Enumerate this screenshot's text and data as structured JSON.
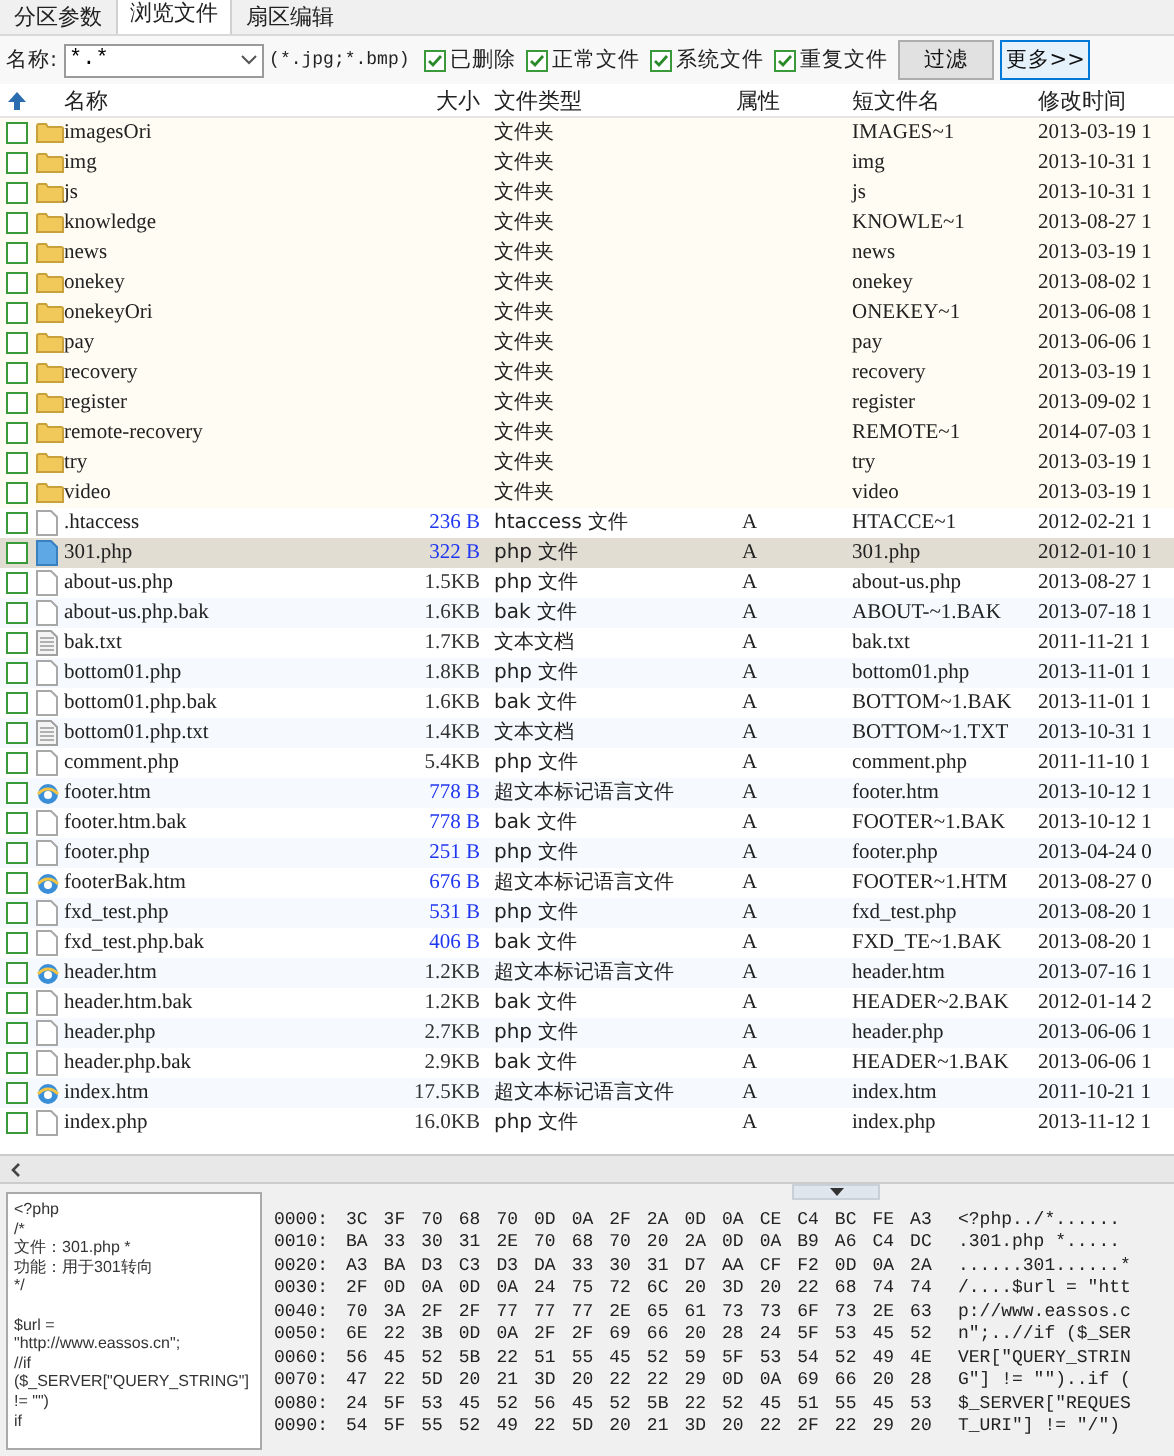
{
  "tabs": [
    {
      "label": "分区参数",
      "selected": false
    },
    {
      "label": "浏览文件",
      "selected": true
    },
    {
      "label": "扇区编辑",
      "selected": false
    }
  ],
  "filter": {
    "label": "名称:",
    "value": "*.*",
    "hint": "(*.jpg;*.bmp)",
    "options": [
      {
        "label": "已删除",
        "checked": true
      },
      {
        "label": "正常文件",
        "checked": true
      },
      {
        "label": "系统文件",
        "checked": true
      },
      {
        "label": "重复文件",
        "checked": true
      }
    ],
    "buttons": [
      {
        "label": "过滤",
        "focused": false
      },
      {
        "label": "更多>>",
        "focused": true
      }
    ]
  },
  "columns": [
    "名称",
    "大小",
    "文件类型",
    "属性",
    "短文件名",
    "修改时间"
  ],
  "rows": [
    {
      "kind": "folder",
      "name": "imagesOri",
      "size": "",
      "type": "文件夹",
      "attr": "",
      "short": "IMAGES~1",
      "modified": "2013-03-19 1",
      "checked": false,
      "selected": false
    },
    {
      "kind": "folder",
      "name": "img",
      "size": "",
      "type": "文件夹",
      "attr": "",
      "short": "img",
      "modified": "2013-10-31 1",
      "checked": false,
      "selected": false
    },
    {
      "kind": "folder",
      "name": "js",
      "size": "",
      "type": "文件夹",
      "attr": "",
      "short": "js",
      "modified": "2013-10-31 1",
      "checked": false,
      "selected": false
    },
    {
      "kind": "folder",
      "name": "knowledge",
      "size": "",
      "type": "文件夹",
      "attr": "",
      "short": "KNOWLE~1",
      "modified": "2013-08-27 1",
      "checked": false,
      "selected": false
    },
    {
      "kind": "folder",
      "name": "news",
      "size": "",
      "type": "文件夹",
      "attr": "",
      "short": "news",
      "modified": "2013-03-19 1",
      "checked": false,
      "selected": false
    },
    {
      "kind": "folder",
      "name": "onekey",
      "size": "",
      "type": "文件夹",
      "attr": "",
      "short": "onekey",
      "modified": "2013-08-02 1",
      "checked": false,
      "selected": false
    },
    {
      "kind": "folder",
      "name": "onekeyOri",
      "size": "",
      "type": "文件夹",
      "attr": "",
      "short": "ONEKEY~1",
      "modified": "2013-06-08 1",
      "checked": false,
      "selected": false
    },
    {
      "kind": "folder",
      "name": "pay",
      "size": "",
      "type": "文件夹",
      "attr": "",
      "short": "pay",
      "modified": "2013-06-06 1",
      "checked": false,
      "selected": false
    },
    {
      "kind": "folder",
      "name": "recovery",
      "size": "",
      "type": "文件夹",
      "attr": "",
      "short": "recovery",
      "modified": "2013-03-19 1",
      "checked": false,
      "selected": false
    },
    {
      "kind": "folder",
      "name": "register",
      "size": "",
      "type": "文件夹",
      "attr": "",
      "short": "register",
      "modified": "2013-09-02 1",
      "checked": false,
      "selected": false
    },
    {
      "kind": "folder",
      "name": "remote-recovery",
      "size": "",
      "type": "文件夹",
      "attr": "",
      "short": "REMOTE~1",
      "modified": "2014-07-03 1",
      "checked": false,
      "selected": false
    },
    {
      "kind": "folder",
      "name": "try",
      "size": "",
      "type": "文件夹",
      "attr": "",
      "short": "try",
      "modified": "2013-03-19 1",
      "checked": false,
      "selected": false
    },
    {
      "kind": "folder",
      "name": "video",
      "size": "",
      "type": "文件夹",
      "attr": "",
      "short": "video",
      "modified": "2013-03-19 1",
      "checked": false,
      "selected": false
    },
    {
      "kind": "file",
      "name": ".htaccess",
      "size": "236 B",
      "type": "htaccess 文件",
      "attr": "A",
      "short": "HTACCE~1",
      "modified": "2012-02-21 1",
      "checked": false,
      "selected": false,
      "small_size": true
    },
    {
      "kind": "file",
      "name": "301.php",
      "size": "322 B",
      "type": "php 文件",
      "attr": "A",
      "short": "301.php",
      "modified": "2012-01-10 1",
      "checked": false,
      "selected": true,
      "small_size": true
    },
    {
      "kind": "file",
      "name": "about-us.php",
      "size": "1.5KB",
      "type": "php 文件",
      "attr": "A",
      "short": "about-us.php",
      "modified": "2013-08-27 1",
      "checked": false,
      "selected": false,
      "small_size": false
    },
    {
      "kind": "file",
      "name": "about-us.php.bak",
      "size": "1.6KB",
      "type": "bak 文件",
      "attr": "A",
      "short": "ABOUT-~1.BAK",
      "modified": "2013-07-18 1",
      "checked": false,
      "selected": false,
      "small_size": false
    },
    {
      "kind": "text",
      "name": "bak.txt",
      "size": "1.7KB",
      "type": "文本文档",
      "attr": "A",
      "short": "bak.txt",
      "modified": "2011-11-21 1",
      "checked": false,
      "selected": false,
      "small_size": false
    },
    {
      "kind": "file",
      "name": "bottom01.php",
      "size": "1.8KB",
      "type": "php 文件",
      "attr": "A",
      "short": "bottom01.php",
      "modified": "2013-11-01 1",
      "checked": false,
      "selected": false,
      "small_size": false
    },
    {
      "kind": "file",
      "name": "bottom01.php.bak",
      "size": "1.6KB",
      "type": "bak 文件",
      "attr": "A",
      "short": "BOTTOM~1.BAK",
      "modified": "2013-11-01 1",
      "checked": false,
      "selected": false,
      "small_size": false
    },
    {
      "kind": "text",
      "name": "bottom01.php.txt",
      "size": "1.4KB",
      "type": "文本文档",
      "attr": "A",
      "short": "BOTTOM~1.TXT",
      "modified": "2013-10-31 1",
      "checked": false,
      "selected": false,
      "small_size": false
    },
    {
      "kind": "file",
      "name": "comment.php",
      "size": "5.4KB",
      "type": "php 文件",
      "attr": "A",
      "short": "comment.php",
      "modified": "2011-11-10 1",
      "checked": false,
      "selected": false,
      "small_size": false
    },
    {
      "kind": "web",
      "name": "footer.htm",
      "size": "778 B",
      "type": "超文本标记语言文件",
      "attr": "A",
      "short": "footer.htm",
      "modified": "2013-10-12 1",
      "checked": false,
      "selected": false,
      "small_size": true
    },
    {
      "kind": "file",
      "name": "footer.htm.bak",
      "size": "778 B",
      "type": "bak 文件",
      "attr": "A",
      "short": "FOOTER~1.BAK",
      "modified": "2013-10-12 1",
      "checked": false,
      "selected": false,
      "small_size": true
    },
    {
      "kind": "file",
      "name": "footer.php",
      "size": "251 B",
      "type": "php 文件",
      "attr": "A",
      "short": "footer.php",
      "modified": "2013-04-24 0",
      "checked": false,
      "selected": false,
      "small_size": true
    },
    {
      "kind": "web",
      "name": "footerBak.htm",
      "size": "676 B",
      "type": "超文本标记语言文件",
      "attr": "A",
      "short": "FOOTER~1.HTM",
      "modified": "2013-08-27 0",
      "checked": false,
      "selected": false,
      "small_size": true
    },
    {
      "kind": "file",
      "name": "fxd_test.php",
      "size": "531 B",
      "type": "php 文件",
      "attr": "A",
      "short": "fxd_test.php",
      "modified": "2013-08-20 1",
      "checked": false,
      "selected": false,
      "small_size": true
    },
    {
      "kind": "file",
      "name": "fxd_test.php.bak",
      "size": "406 B",
      "type": "bak 文件",
      "attr": "A",
      "short": "FXD_TE~1.BAK",
      "modified": "2013-08-20 1",
      "checked": false,
      "selected": false,
      "small_size": true
    },
    {
      "kind": "web",
      "name": "header.htm",
      "size": "1.2KB",
      "type": "超文本标记语言文件",
      "attr": "A",
      "short": "header.htm",
      "modified": "2013-07-16 1",
      "checked": false,
      "selected": false,
      "small_size": false
    },
    {
      "kind": "file",
      "name": "header.htm.bak",
      "size": "1.2KB",
      "type": "bak 文件",
      "attr": "A",
      "short": "HEADER~2.BAK",
      "modified": "2012-01-14 2",
      "checked": false,
      "selected": false,
      "small_size": false
    },
    {
      "kind": "file",
      "name": "header.php",
      "size": "2.7KB",
      "type": "php 文件",
      "attr": "A",
      "short": "header.php",
      "modified": "2013-06-06 1",
      "checked": false,
      "selected": false,
      "small_size": false
    },
    {
      "kind": "file",
      "name": "header.php.bak",
      "size": "2.9KB",
      "type": "bak 文件",
      "attr": "A",
      "short": "HEADER~1.BAK",
      "modified": "2013-06-06 1",
      "checked": false,
      "selected": false,
      "small_size": false
    },
    {
      "kind": "web",
      "name": "index.htm",
      "size": "17.5KB",
      "type": "超文本标记语言文件",
      "attr": "A",
      "short": "index.htm",
      "modified": "2011-10-21 1",
      "checked": false,
      "selected": false,
      "small_size": false
    },
    {
      "kind": "file",
      "name": "index.php",
      "size": "16.0KB",
      "type": "php 文件",
      "attr": "A",
      "short": "index.php",
      "modified": "2013-11-12 1",
      "checked": false,
      "selected": false,
      "small_size": false
    }
  ],
  "preview": {
    "paragraphs": [
      [
        "<?php",
        "/*",
        "文件：301.php *",
        "功能：用于301转向",
        "*/"
      ],
      [
        "$url =",
        "\"http://www.eassos.cn\";",
        "//if",
        "($_SERVER[\"QUERY_STRING\"]",
        "!= \"\")",
        "if"
      ]
    ]
  },
  "hex": [
    {
      "offset": "0000:",
      "bytes": "3C 3F 70 68 70 0D 0A 2F 2A 0D 0A CE C4 BC FE A3",
      "ascii": "<?php../*......"
    },
    {
      "offset": "0010:",
      "bytes": "BA 33 30 31 2E 70 68 70 20 2A 0D 0A B9 A6 C4 DC",
      "ascii": ".301.php *....."
    },
    {
      "offset": "0020:",
      "bytes": "A3 BA D3 C3 D3 DA 33 30 31 D7 AA CF F2 0D 0A 2A",
      "ascii": "......301......*"
    },
    {
      "offset": "0030:",
      "bytes": "2F 0D 0A 0D 0A 24 75 72 6C 20 3D 20 22 68 74 74",
      "ascii": "/....$url = \"htt"
    },
    {
      "offset": "0040:",
      "bytes": "70 3A 2F 2F 77 77 77 2E 65 61 73 73 6F 73 2E 63",
      "ascii": "p://www.eassos.c"
    },
    {
      "offset": "0050:",
      "bytes": "6E 22 3B 0D 0A 2F 2F 69 66 20 28 24 5F 53 45 52",
      "ascii": "n\";..//if ($_SER"
    },
    {
      "offset": "0060:",
      "bytes": "56 45 52 5B 22 51 55 45 52 59 5F 53 54 52 49 4E",
      "ascii": "VER[\"QUERY_STRIN"
    },
    {
      "offset": "0070:",
      "bytes": "47 22 5D 20 21 3D 20 22 22 29 0D 0A 69 66 20 28",
      "ascii": "G\"] != \"\")..if ("
    },
    {
      "offset": "0080:",
      "bytes": "24 5F 53 45 52 56 45 52 5B 22 52 45 51 55 45 53",
      "ascii": "$_SERVER[\"REQUES"
    },
    {
      "offset": "0090:",
      "bytes": "54 5F 55 52 49 22 5D 20 21 3D 20 22 2F 22 29 20",
      "ascii": "T_URI\"] != \"/\") "
    }
  ]
}
